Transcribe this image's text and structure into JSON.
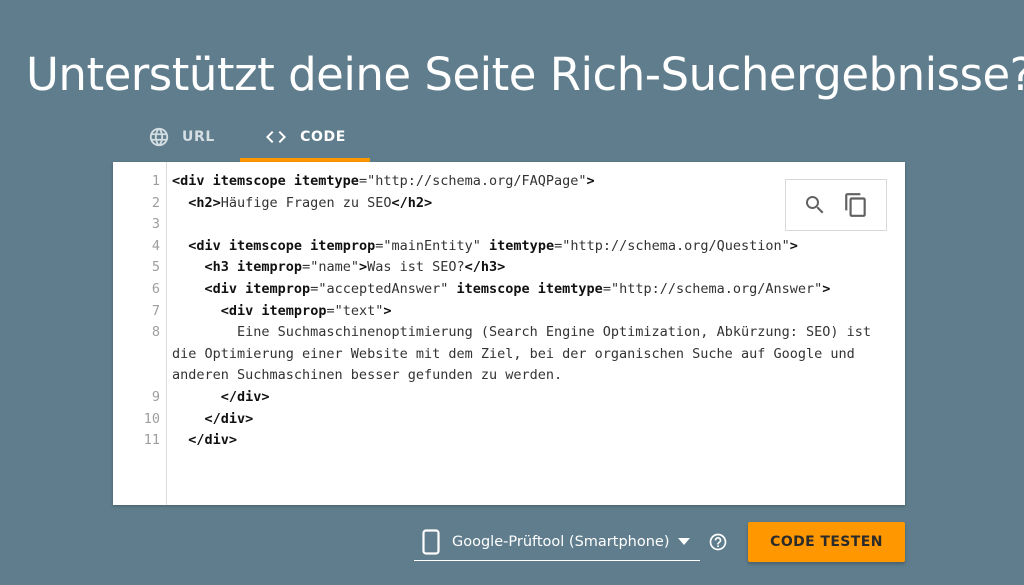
{
  "page": {
    "title": "Unterstützt deine Seite Rich-Suchergebnisse?"
  },
  "tabs": [
    {
      "label": "URL",
      "icon": "globe-icon",
      "active": false
    },
    {
      "label": "CODE",
      "icon": "code-icon",
      "active": true
    }
  ],
  "editor": {
    "line_numbers": [
      "1",
      "2",
      "3",
      "4",
      "5",
      "6",
      "7",
      "8",
      "9",
      "10",
      "11"
    ],
    "lines": [
      [
        [
          "tag",
          "<div "
        ],
        [
          "attr",
          "itemscope itemtype"
        ],
        [
          "txt",
          "="
        ],
        [
          "str",
          "\"http://schema.org/FAQPage\""
        ],
        [
          "tag",
          ">"
        ]
      ],
      [
        [
          "txt",
          "  "
        ],
        [
          "tag",
          "<h2>"
        ],
        [
          "txt",
          "Häufige Fragen zu SEO"
        ],
        [
          "tag",
          "</h2>"
        ]
      ],
      [],
      [
        [
          "txt",
          "  "
        ],
        [
          "tag",
          "<div "
        ],
        [
          "attr",
          "itemscope itemprop"
        ],
        [
          "txt",
          "="
        ],
        [
          "str",
          "\"mainEntity\""
        ],
        [
          "txt",
          " "
        ],
        [
          "attr",
          "itemtype"
        ],
        [
          "txt",
          "="
        ],
        [
          "str",
          "\"http://schema.org/Question\""
        ],
        [
          "tag",
          ">"
        ]
      ],
      [
        [
          "txt",
          "    "
        ],
        [
          "tag",
          "<h3 "
        ],
        [
          "attr",
          "itemprop"
        ],
        [
          "txt",
          "="
        ],
        [
          "str",
          "\"name\""
        ],
        [
          "tag",
          ">"
        ],
        [
          "txt",
          "Was ist SEO?"
        ],
        [
          "tag",
          "</h3>"
        ]
      ],
      [
        [
          "txt",
          "    "
        ],
        [
          "tag",
          "<div "
        ],
        [
          "attr",
          "itemprop"
        ],
        [
          "txt",
          "="
        ],
        [
          "str",
          "\"acceptedAnswer\""
        ],
        [
          "txt",
          " "
        ],
        [
          "attr",
          "itemscope itemtype"
        ],
        [
          "txt",
          "="
        ],
        [
          "str",
          "\"http://schema.org/Answer\""
        ],
        [
          "tag",
          ">"
        ]
      ],
      [
        [
          "txt",
          "      "
        ],
        [
          "tag",
          "<div "
        ],
        [
          "attr",
          "itemprop"
        ],
        [
          "txt",
          "="
        ],
        [
          "str",
          "\"text\""
        ],
        [
          "tag",
          ">"
        ]
      ],
      [
        [
          "txt",
          "        Eine Suchmaschinenoptimierung (Search Engine Optimization, Abkürzung: SEO) ist die Optimierung einer Website mit dem Ziel, bei der organischen Suche auf Google und anderen Suchmaschinen besser gefunden zu werden."
        ]
      ],
      [
        [
          "txt",
          "      "
        ],
        [
          "tag",
          "</div>"
        ]
      ],
      [
        [
          "txt",
          "    "
        ],
        [
          "tag",
          "</div>"
        ]
      ],
      [
        [
          "txt",
          "  "
        ],
        [
          "tag",
          "</div>"
        ]
      ]
    ],
    "tools": {
      "search_icon": "search-icon",
      "copy_icon": "copy-icon"
    }
  },
  "device_select": {
    "icon": "smartphone-icon",
    "value": "Google-Prüftool (Smartphone)"
  },
  "help_icon": "help-icon",
  "test_button": {
    "label": "CODE TESTEN"
  },
  "colors": {
    "background": "#5f7d8c",
    "accent": "#ff9800",
    "editor_bg": "#ffffff"
  }
}
